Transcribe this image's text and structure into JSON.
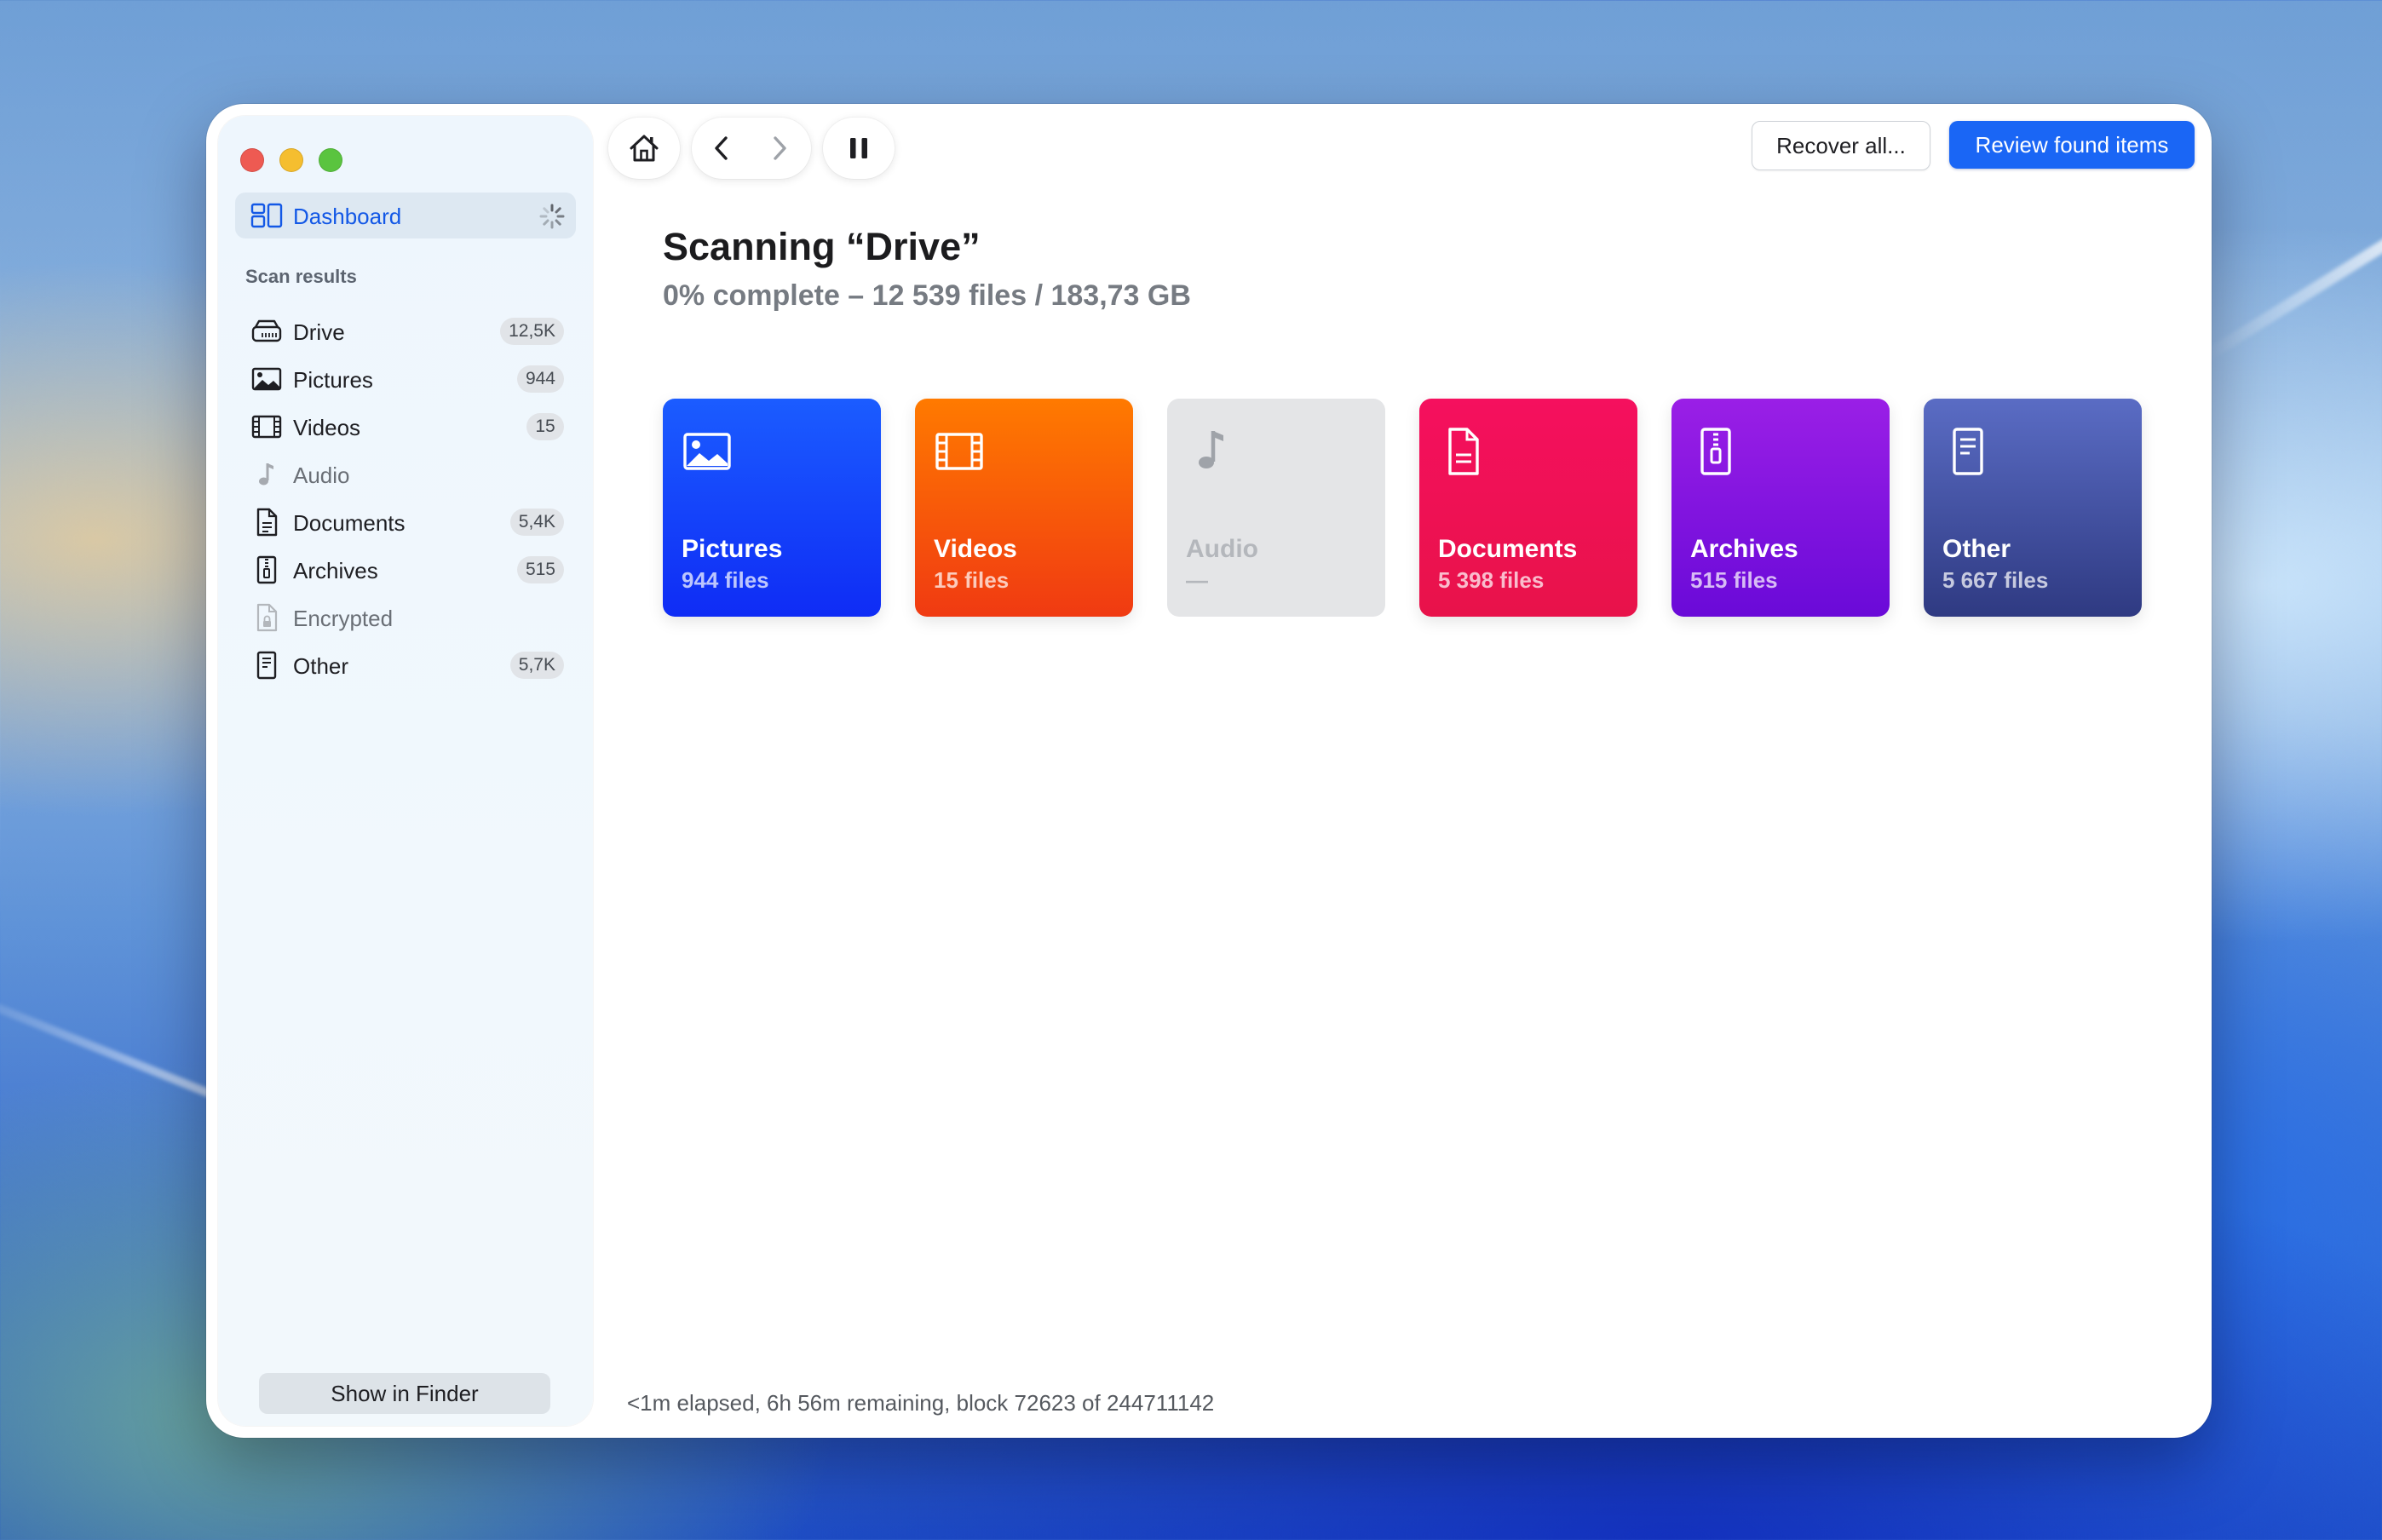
{
  "window": {
    "traffic_lights": [
      "close",
      "minimize",
      "zoom"
    ]
  },
  "sidebar": {
    "dashboard_label": "Dashboard",
    "section_label": "Scan results",
    "items": [
      {
        "label": "Drive",
        "badge": "12,5K",
        "icon": "drive-icon"
      },
      {
        "label": "Pictures",
        "badge": "944",
        "icon": "pictures-icon"
      },
      {
        "label": "Videos",
        "badge": "15",
        "icon": "videos-icon"
      },
      {
        "label": "Audio",
        "badge": "",
        "icon": "audio-icon"
      },
      {
        "label": "Documents",
        "badge": "5,4K",
        "icon": "documents-icon"
      },
      {
        "label": "Archives",
        "badge": "515",
        "icon": "archives-icon"
      },
      {
        "label": "Encrypted",
        "badge": "",
        "icon": "encrypted-icon"
      },
      {
        "label": "Other",
        "badge": "5,7K",
        "icon": "other-icon"
      }
    ],
    "show_in_finder": "Show in Finder"
  },
  "toolbar": {
    "recover_all": "Recover all...",
    "review_found": "Review found items"
  },
  "main": {
    "title": "Scanning “Drive”",
    "subtitle": "0% complete – 12 539 files / 183,73 GB",
    "tiles": [
      {
        "name": "Pictures",
        "count": "944 files",
        "color": "#1b5cff"
      },
      {
        "name": "Videos",
        "count": "15 files",
        "color": "#ff6a00"
      },
      {
        "name": "Audio",
        "count": "—",
        "color": "#e4e5e7"
      },
      {
        "name": "Documents",
        "count": "5 398 files",
        "color": "#f5105e"
      },
      {
        "name": "Archives",
        "count": "515 files",
        "color": "#8a18e0"
      },
      {
        "name": "Other",
        "count": "5 667 files",
        "color": "#47539e"
      }
    ],
    "status": "<1m elapsed, 6h 56m remaining, block 72623 of 244711142"
  },
  "colors": {
    "accent": "#1a66f5",
    "close": "#ee5a52",
    "minimize": "#f5be2f",
    "zoom": "#5ac43f"
  }
}
